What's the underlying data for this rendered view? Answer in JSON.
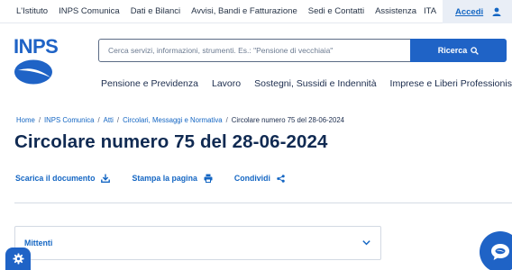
{
  "topbar": {
    "links": [
      "L'Istituto",
      "INPS Comunica",
      "Dati e Bilanci",
      "Avvisi, Bandi e Fatturazione",
      "Sedi e Contatti",
      "Assistenza"
    ],
    "lang": "ITA",
    "login_label": "Accedi"
  },
  "header": {
    "logo_text": "INPS",
    "search_placeholder": "Cerca servizi, informazioni, strumenti. Es.: \"Pensione di vecchiaia\"",
    "search_button": "Ricerca"
  },
  "nav": [
    "Pensione e Previdenza",
    "Lavoro",
    "Sostegni, Sussidi e Indennità",
    "Imprese e Liberi Professionisti"
  ],
  "breadcrumb": [
    "Home",
    "INPS Comunica",
    "Atti",
    "Circolari, Messaggi e Normativa",
    "Circolare numero 75 del 28-06-2024"
  ],
  "page": {
    "title": "Circolare numero 75 del 28-06-2024",
    "actions": {
      "download": "Scarica il documento",
      "print": "Stampa la pagina",
      "share": "Condividi"
    },
    "accordion_label": "Mittenti"
  },
  "colors": {
    "brand": "#1f63c6",
    "link": "#1466c3",
    "text": "#102a52"
  }
}
